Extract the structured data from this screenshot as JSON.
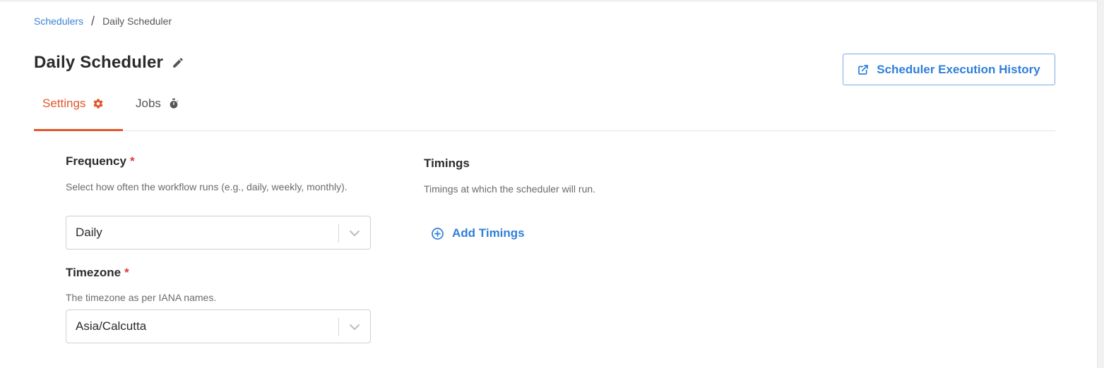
{
  "breadcrumb": {
    "parent": "Schedulers",
    "separator": "/",
    "current": "Daily Scheduler"
  },
  "header": {
    "title": "Daily Scheduler",
    "history_button": "Scheduler Execution History"
  },
  "tabs": [
    {
      "label": "Settings",
      "active": true,
      "icon": "gear-icon"
    },
    {
      "label": "Jobs",
      "active": false,
      "icon": "stopwatch-icon"
    }
  ],
  "frequency": {
    "label": "Frequency",
    "required_mark": "*",
    "help": "Select how often the workflow runs (e.g., daily, weekly, monthly).",
    "value": "Daily"
  },
  "timezone": {
    "label": "Timezone",
    "required_mark": "*",
    "help": "The timezone as per IANA names.",
    "value": "Asia/Calcutta"
  },
  "timings": {
    "label": "Timings",
    "help": "Timings at which the scheduler will run.",
    "add_label": "Add Timings"
  },
  "colors": {
    "accent_orange": "#e2572b",
    "link_blue": "#2f7fd9",
    "required_red": "#e03a3a"
  }
}
